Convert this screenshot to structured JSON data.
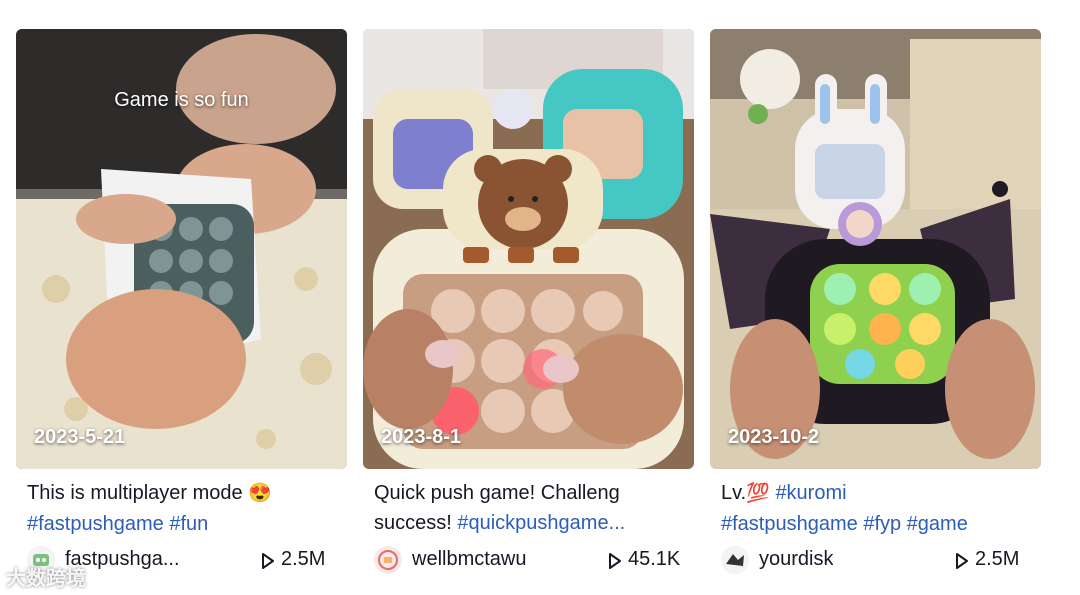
{
  "videos": [
    {
      "date": "2023-5-21",
      "overlay_text": "Game is so fun",
      "caption": {
        "line1_text": "This is multiplayer mode ",
        "emoji": "😍",
        "hashtags": "#fastpushgame #fun"
      },
      "author": "fastpushga...",
      "views": "2.5M",
      "accent": "#4b5f5f"
    },
    {
      "date": "2023-8-1",
      "caption": {
        "line1_text": "Quick push game! Challeng",
        "line2_text": "success! ",
        "hashtags": "#quickpushgame..."
      },
      "author": "wellbmctawu",
      "views": "45.1K",
      "accent": "#e8c9b5"
    },
    {
      "date": "2023-10-2",
      "caption": {
        "line1_text": "Lv.",
        "emoji": "💯",
        "hashtag1": "#kuromi",
        "hashtags": "#fastpushgame #fyp #game"
      },
      "author": "yourdisk",
      "views": "2.5M",
      "accent": "#8fd14f"
    }
  ],
  "watermark": "大数跨境",
  "colors": {
    "hashtag": "#2b5db9",
    "text": "#161823"
  },
  "icons": [
    "play-icon",
    "avatar-icon"
  ]
}
